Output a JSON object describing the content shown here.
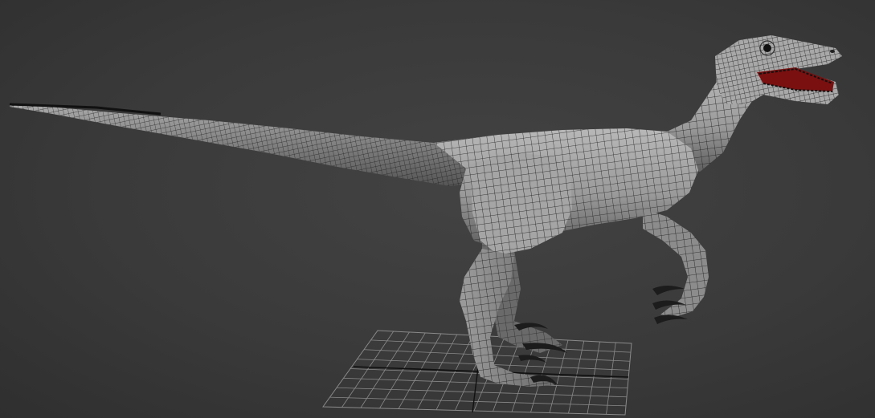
{
  "viewport": {
    "background_color": "#3a3a3a",
    "grid_color": "#8a8a8a",
    "grid_axis_color": "#111111"
  },
  "model": {
    "body_color": "#9a9a9a",
    "body_highlight_color": "#bdbdbd",
    "body_shadow_color": "#5c5c5c",
    "wire_color": "#1a1a1a",
    "mouth_color": "#7a1010",
    "claw_color": "#1c1c1c"
  }
}
